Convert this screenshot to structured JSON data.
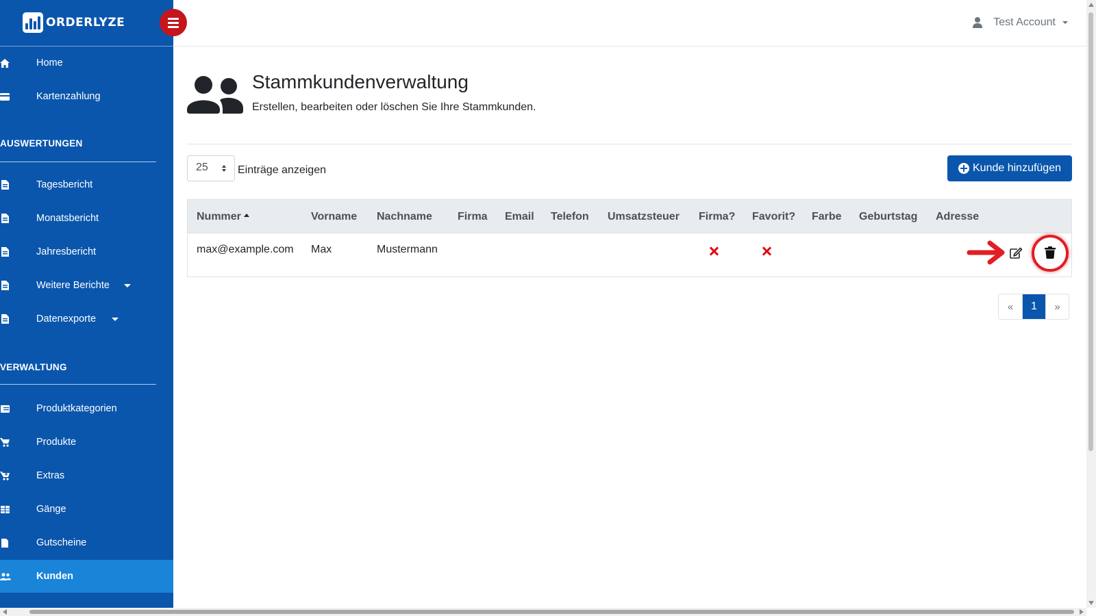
{
  "brand": {
    "name": "ORDERLYZE"
  },
  "account": {
    "label": "Test Account"
  },
  "sidebar": {
    "items_top": [
      {
        "label": "Home",
        "icon": "home-icon"
      },
      {
        "label": "Kartenzahlung",
        "icon": "credit-card-icon"
      }
    ],
    "section_reports": "AUSWERTUNGEN",
    "items_reports": [
      {
        "label": "Tagesbericht",
        "icon": "file-icon"
      },
      {
        "label": "Monatsbericht",
        "icon": "file-icon"
      },
      {
        "label": "Jahresbericht",
        "icon": "file-icon"
      },
      {
        "label": "Weitere Berichte",
        "icon": "file-icon",
        "dropdown": true
      },
      {
        "label": "Datenexporte",
        "icon": "file-icon",
        "dropdown": true
      }
    ],
    "section_admin": "VERWALTUNG",
    "items_admin": [
      {
        "label": "Produktkategorien",
        "icon": "list-icon"
      },
      {
        "label": "Produkte",
        "icon": "cart-icon"
      },
      {
        "label": "Extras",
        "icon": "cart-plus-icon"
      },
      {
        "label": "Gänge",
        "icon": "table-icon"
      },
      {
        "label": "Gutscheine",
        "icon": "ticket-icon"
      },
      {
        "label": "Kunden",
        "icon": "users-icon",
        "active": true
      }
    ]
  },
  "page": {
    "title": "Stammkundenverwaltung",
    "subtitle": "Erstellen, bearbeiten oder löschen Sie Ihre Stammkunden.",
    "icon": "users-icon"
  },
  "controls": {
    "page_length": "25",
    "page_length_label": "Einträge anzeigen",
    "add_button": "Kunde hinzufügen"
  },
  "table": {
    "columns": [
      "Nummer",
      "Vorname",
      "Nachname",
      "Firma",
      "Email",
      "Telefon",
      "Umsatzsteuer",
      "Firma?",
      "Favorit?",
      "Farbe",
      "Geburtstag",
      "Adresse"
    ],
    "sorted_column": "Nummer",
    "rows": [
      {
        "nummer": "max@example.com",
        "vorname": "Max",
        "nachname": "Mustermann",
        "firma": "",
        "email": "",
        "telefon": "",
        "umsatzsteuer": "",
        "ist_firma": false,
        "favorit": false,
        "farbe": "",
        "geburtstag": "",
        "adresse": ""
      }
    ]
  },
  "pagination": {
    "prev": "«",
    "current": "1",
    "next": "»"
  },
  "colors": {
    "primary": "#0a56ad",
    "active_nav": "#1a84d9",
    "toggle": "#c4161c",
    "highlight": "#e01e24",
    "false_mark": "#e3080f"
  }
}
